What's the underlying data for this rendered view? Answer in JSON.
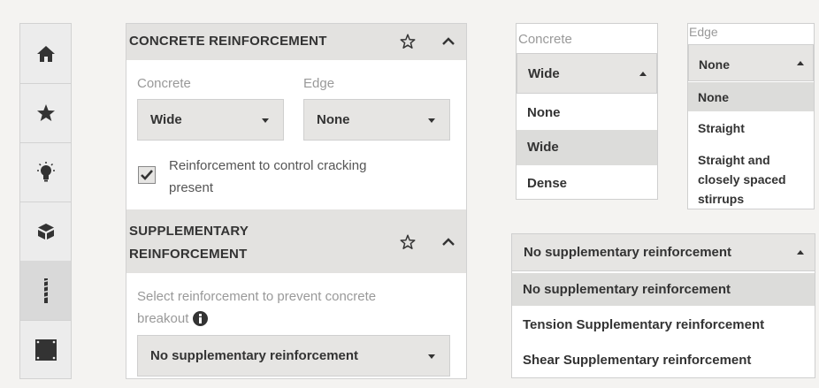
{
  "sidebar": {
    "items": [
      {
        "icon": "home-icon"
      },
      {
        "icon": "star-icon"
      },
      {
        "icon": "lightbulb-icon"
      },
      {
        "icon": "cube-icon"
      },
      {
        "icon": "rebar-icon",
        "active": true
      },
      {
        "icon": "plate-icon"
      }
    ]
  },
  "concrete_section": {
    "title": "CONCRETE REINFORCEMENT",
    "concrete_label": "Concrete",
    "concrete_value": "Wide",
    "edge_label": "Edge",
    "edge_value": "None",
    "checkbox_label_line1": "Reinforcement to control cracking",
    "checkbox_label_line2": "present",
    "checkbox_checked": true
  },
  "supplementary_section": {
    "title_line1": "SUPPLEMENTARY",
    "title_line2": "REINFORCEMENT",
    "prompt_line1": "Select reinforcement to prevent concrete",
    "prompt_line2": "breakout",
    "value": "No supplementary reinforcement"
  },
  "concrete_dropdown": {
    "label": "Concrete",
    "selected": "Wide",
    "options": [
      "None",
      "Wide",
      "Dense"
    ]
  },
  "edge_dropdown": {
    "label": "Edge",
    "selected": "None",
    "options": [
      "None",
      "Straight",
      "Straight and",
      "closely spaced",
      "stirrups"
    ]
  },
  "supplementary_dropdown": {
    "selected": "No supplementary reinforcement",
    "options": [
      "No supplementary reinforcement",
      "Tension Supplementary reinforcement",
      "Shear Supplementary reinforcement"
    ]
  },
  "colors": {
    "header_bg": "#e3e2e0",
    "select_bg": "#e6e5e3",
    "highlight_bg": "#dcdcda",
    "label_gray": "#999999",
    "text_dark": "#333333"
  }
}
